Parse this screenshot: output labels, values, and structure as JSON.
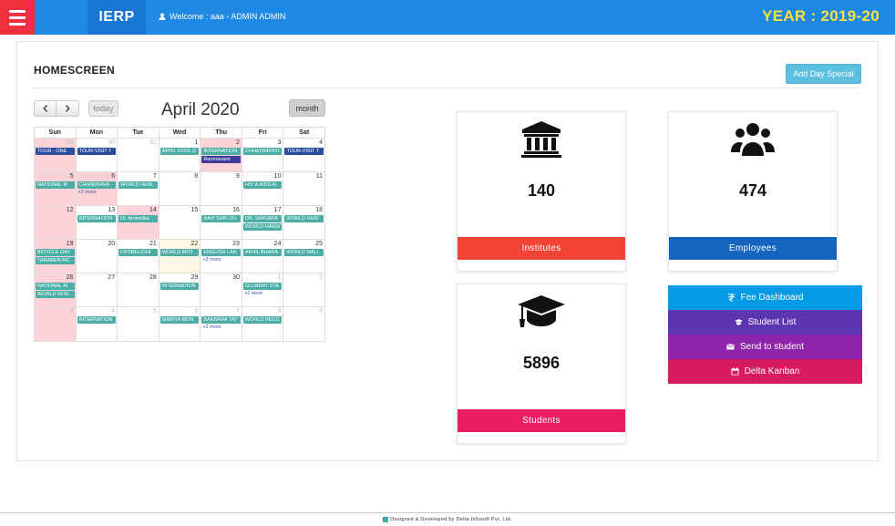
{
  "header": {
    "app_title": "IERP",
    "welcome_text": "Welcome : aaa - ADMIN ADMIN",
    "year_text": "YEAR : 2019-20"
  },
  "page": {
    "title": "HOMESCREEN",
    "add_day_label": "Add Day Special"
  },
  "calendar": {
    "title": "April 2020",
    "today_label": "today",
    "month_label": "month",
    "prev_icon": "chevron-left-icon",
    "next_icon": "chevron-right-icon",
    "days_of_week": [
      "Sun",
      "Mon",
      "Tue",
      "Wed",
      "Thu",
      "Fri",
      "Sat"
    ],
    "weeks": [
      [
        {
          "n": "29",
          "other": true,
          "hol": true,
          "events": [
            {
              "t": "TOUR - ONE",
              "c": "navy"
            }
          ]
        },
        {
          "n": "30",
          "other": true,
          "events": [
            {
              "t": "TOUR-VISIT T",
              "c": "navy"
            }
          ]
        },
        {
          "n": "31",
          "other": true,
          "events": []
        },
        {
          "n": "1",
          "events": [
            {
              "t": "APRIL FOOL D",
              "c": "teal"
            }
          ]
        },
        {
          "n": "2",
          "hol": true,
          "events": [
            {
              "t": "INTERNATION",
              "c": "teal"
            },
            {
              "t": "Ramnavami",
              "c": "purple"
            }
          ]
        },
        {
          "n": "3",
          "events": [
            {
              "t": "CHHATRAPATI",
              "c": "teal"
            }
          ]
        },
        {
          "n": "4",
          "events": [
            {
              "t": "TOUR-VISIT T",
              "c": "navy"
            }
          ]
        }
      ],
      [
        {
          "n": "5",
          "hol": true,
          "events": [
            {
              "t": "NATIONAL M",
              "c": "teal"
            }
          ]
        },
        {
          "n": "6",
          "hol": true,
          "events": [
            {
              "t": "CHANDRAVA",
              "c": "teal"
            }
          ],
          "more": "+2 more"
        },
        {
          "n": "7",
          "events": [
            {
              "t": "WORLD HEAL",
              "c": "teal"
            }
          ]
        },
        {
          "n": "8",
          "events": []
        },
        {
          "n": "9",
          "events": []
        },
        {
          "n": "10",
          "events": [
            {
              "t": "HIV & AIDS AI",
              "c": "teal"
            }
          ]
        },
        {
          "n": "11",
          "events": []
        }
      ],
      [
        {
          "n": "12",
          "hol": true,
          "events": []
        },
        {
          "n": "13",
          "events": [
            {
              "t": "INTERNATION",
              "c": "teal"
            }
          ]
        },
        {
          "n": "14",
          "hol": true,
          "events": [
            {
              "t": "Dr. Ambedka",
              "c": "teal"
            }
          ]
        },
        {
          "n": "15",
          "events": []
        },
        {
          "n": "16",
          "events": [
            {
              "t": "KAVI SHRI ZH",
              "c": "teal"
            }
          ]
        },
        {
          "n": "17",
          "events": [
            {
              "t": "DR. SARVAPA",
              "c": "teal"
            },
            {
              "t": "WORLD HAEM",
              "c": "teal"
            }
          ]
        },
        {
          "n": "18",
          "events": [
            {
              "t": "WORLD HERI",
              "c": "teal"
            }
          ]
        }
      ],
      [
        {
          "n": "19",
          "hol": true,
          "events": [
            {
              "t": "BICYCLE DAY",
              "c": "teal"
            },
            {
              "t": "TARABEN MC",
              "c": "teal"
            }
          ]
        },
        {
          "n": "20",
          "events": []
        },
        {
          "n": "21",
          "events": [
            {
              "t": "FROBEL(CHI",
              "c": "teal"
            }
          ]
        },
        {
          "n": "22",
          "today": true,
          "events": [
            {
              "t": "WORLD MOT",
              "c": "teal"
            }
          ]
        },
        {
          "n": "23",
          "events": [
            {
              "t": "ENGLISH LAN",
              "c": "teal"
            }
          ],
          "more": "+2 more"
        },
        {
          "n": "24",
          "events": [
            {
              "t": "AKHIL BHARA",
              "c": "teal"
            }
          ]
        },
        {
          "n": "25",
          "events": [
            {
              "t": "WORLD MAL/",
              "c": "teal"
            }
          ]
        }
      ],
      [
        {
          "n": "26",
          "hol": true,
          "events": [
            {
              "t": "NATIONAL AI",
              "c": "teal"
            },
            {
              "t": "WORLD INTE",
              "c": "teal"
            }
          ]
        },
        {
          "n": "27",
          "events": []
        },
        {
          "n": "28",
          "events": []
        },
        {
          "n": "29",
          "events": [
            {
              "t": "INTERNATION",
              "c": "teal"
            }
          ]
        },
        {
          "n": "30",
          "events": []
        },
        {
          "n": "1",
          "other": true,
          "events": [
            {
              "t": "GUJARAT STA",
              "c": "teal"
            }
          ],
          "more": "+2 more"
        },
        {
          "n": "2",
          "other": true,
          "events": []
        }
      ],
      [
        {
          "n": "3",
          "other": true,
          "hol": true,
          "events": []
        },
        {
          "n": "4",
          "other": true,
          "events": [
            {
              "t": "INTERNATION",
              "c": "teal"
            }
          ]
        },
        {
          "n": "5",
          "other": true,
          "events": []
        },
        {
          "n": "6",
          "other": true,
          "events": [
            {
              "t": "MARIYA MON",
              "c": "teal"
            }
          ]
        },
        {
          "n": "7",
          "other": true,
          "events": [
            {
              "t": "BARBARA TAY",
              "c": "teal"
            }
          ],
          "more": "+2 more"
        },
        {
          "n": "8",
          "other": true,
          "events": [
            {
              "t": "WORLD RECO",
              "c": "teal"
            }
          ]
        },
        {
          "n": "9",
          "other": true,
          "events": []
        }
      ]
    ]
  },
  "stats": {
    "institutes": {
      "value": "140",
      "label": "Institutes",
      "icon": "institution-icon",
      "color": "#f44336"
    },
    "employees": {
      "value": "474",
      "label": "Employees",
      "icon": "users-icon",
      "color": "#1565c0"
    },
    "students": {
      "value": "5896",
      "label": "Students",
      "icon": "graduation-cap-icon",
      "color": "#e91e63"
    }
  },
  "links": [
    {
      "label": "Fee Dashboard",
      "icon": "rupee-icon",
      "color": "#039be5"
    },
    {
      "label": "Student List",
      "icon": "graduation-cap-icon",
      "color": "#5e35b1"
    },
    {
      "label": "Send to student",
      "icon": "envelope-icon",
      "color": "#8e24aa"
    },
    {
      "label": "Delta Kanban",
      "icon": "calendar-icon",
      "color": "#d81b60"
    }
  ],
  "footer": {
    "text": "Designed & Developed by Delta Infosoft Pvt. Ltd."
  }
}
